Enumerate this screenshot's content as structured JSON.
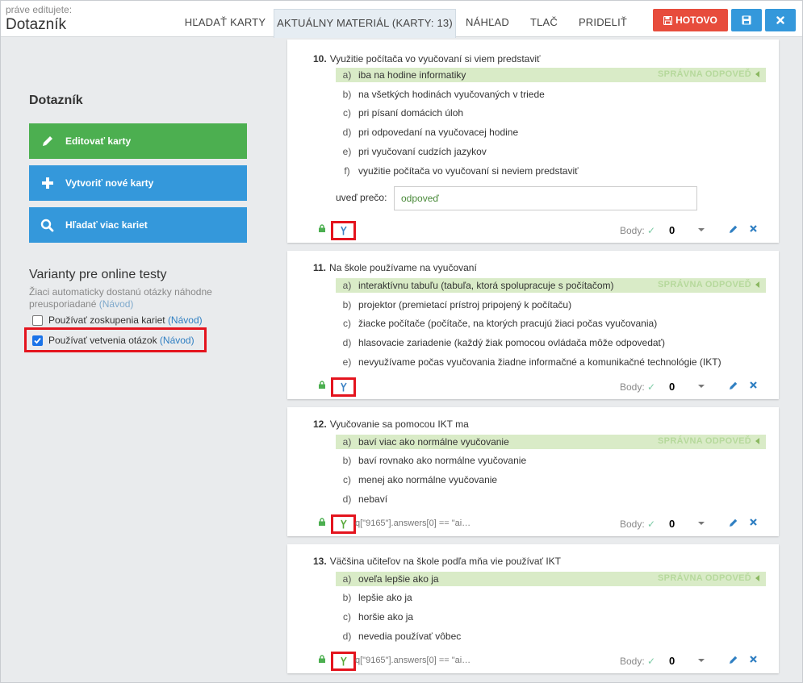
{
  "header": {
    "editing_label": "práve editujete:",
    "title": "Dotazník",
    "tabs": [
      "HĽADAŤ KARTY",
      "AKTUÁLNY MATERIÁL (KARTY: 13)",
      "NÁHĽAD",
      "TLAČ",
      "PRIDELIŤ"
    ],
    "active_tab": 1,
    "done_label": "HOTOVO",
    "colors": {
      "done": "#e74c3c",
      "primary": "#3498db"
    }
  },
  "sidebar": {
    "title": "Dotazník",
    "buttons": [
      "Editovať karty",
      "Vytvoriť nové karty",
      "Hľadať viac kariet"
    ],
    "variants_title": "Varianty pre online testy",
    "variants_desc": "Žiaci automaticky dostanú otázky náhodne preusporiadané",
    "guide_link": "(Návod)",
    "options": [
      {
        "label": "Používať zoskupenia kariet",
        "link": "(Návod)",
        "checked": false
      },
      {
        "label": "Používať vetvenia otázok",
        "link": "(Návod)",
        "checked": true
      }
    ]
  },
  "common": {
    "correct_label": "SPRÁVNA ODPOVEĎ",
    "body_label": "Body:",
    "why_label": "uveď prečo:",
    "why_value": "odpoveď"
  },
  "questions": [
    {
      "number": "10.",
      "text": "Využitie počítača vo vyučovaní si viem predstaviť",
      "answers": [
        {
          "letter": "a)",
          "text": "iba na hodine informatiky",
          "correct": true
        },
        {
          "letter": "b)",
          "text": "na všetkých hodinách vyučovaných v triede"
        },
        {
          "letter": "c)",
          "text": "pri písaní domácich úloh"
        },
        {
          "letter": "d)",
          "text": "pri odpovedaní na vyučovacej hodine"
        },
        {
          "letter": "e)",
          "text": "pri vyučovaní cudzích jazykov"
        },
        {
          "letter": "f)",
          "text": "využitie počítača vo vyučovaní si neviem predstaviť"
        }
      ],
      "condition": "",
      "points": "0"
    },
    {
      "number": "11.",
      "text": "Na škole používame na vyučovaní",
      "answers": [
        {
          "letter": "a)",
          "text": "interaktívnu tabuľu (tabuľa, ktorá spolupracuje s počítačom)",
          "correct": true
        },
        {
          "letter": "b)",
          "text": "projektor (premietací prístroj pripojený k počítaču)"
        },
        {
          "letter": "c)",
          "text": "žiacke počítače (počítače, na ktorých pracujú žiaci počas vyučovania)"
        },
        {
          "letter": "d)",
          "text": "hlasovacie zariadenie (každý žiak pomocou ovládača môže odpovedať)"
        },
        {
          "letter": "e)",
          "text": "nevyužívame počas vyučovania žiadne informačné a komunikačné technológie (IKT)"
        }
      ],
      "condition": "",
      "points": "0"
    },
    {
      "number": "12.",
      "text": "Vyučovanie sa pomocou IKT ma",
      "answers": [
        {
          "letter": "a)",
          "text": "baví viac ako normálne vyučovanie",
          "correct": true
        },
        {
          "letter": "b)",
          "text": "baví rovnako ako normálne vyučovanie"
        },
        {
          "letter": "c)",
          "text": "menej ako normálne vyučovanie"
        },
        {
          "letter": "d)",
          "text": "nebaví"
        }
      ],
      "condition": "q[\"9165\"].answers[0] == \"ai…",
      "points": "0"
    },
    {
      "number": "13.",
      "text": "Väčšina učiteľov na škole podľa mňa vie používať IKT",
      "answers": [
        {
          "letter": "a)",
          "text": "oveľa lepšie ako ja",
          "correct": true
        },
        {
          "letter": "b)",
          "text": "lepšie ako ja"
        },
        {
          "letter": "c)",
          "text": "horšie ako ja"
        },
        {
          "letter": "d)",
          "text": "nevedia používať vôbec"
        }
      ],
      "condition": "q[\"9165\"].answers[0] == \"ai…",
      "points": "0"
    }
  ]
}
